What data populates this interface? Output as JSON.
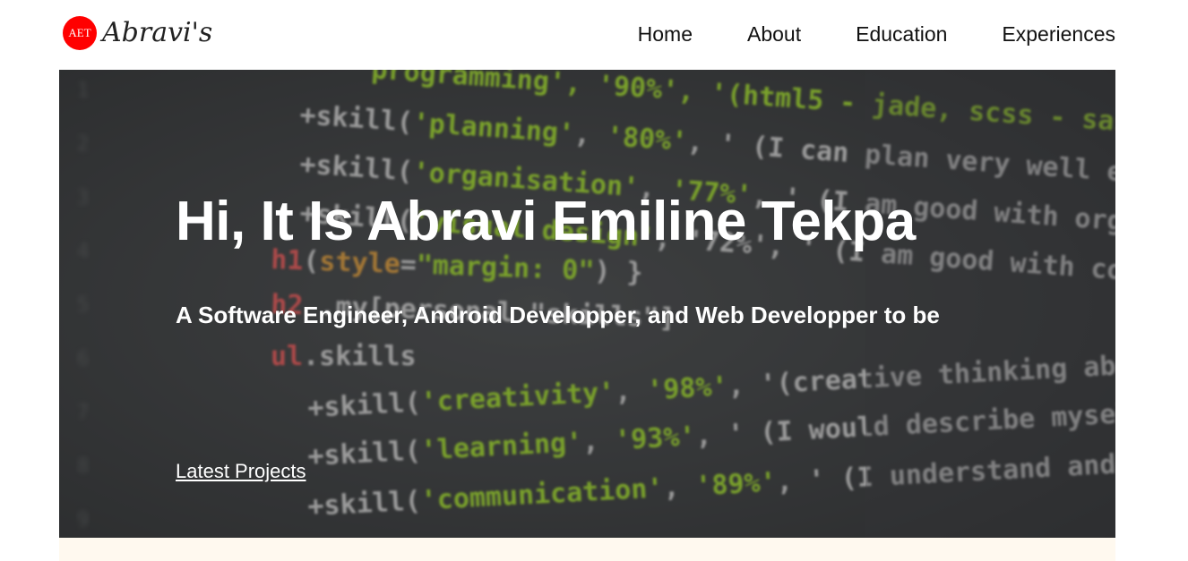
{
  "logo": {
    "badge": "AET",
    "text": "Abravi's"
  },
  "nav": {
    "items": [
      "Home",
      "About",
      "Education",
      "Experiences"
    ]
  },
  "hero": {
    "title": "Hi, It Is Abravi Emiline Tekpa",
    "subtitle": "A Software Engineer, Android Developper, and Web Developper to be",
    "link_label": "Latest Projects",
    "background_icon": "code-editor-image"
  },
  "colors": {
    "badge": "#ff0000",
    "code_green": "#a6e22e",
    "code_white": "#d8d8d8",
    "code_red": "#f25c5c",
    "code_orange": "#e6a23c",
    "below_band": "#fff9ef"
  }
}
